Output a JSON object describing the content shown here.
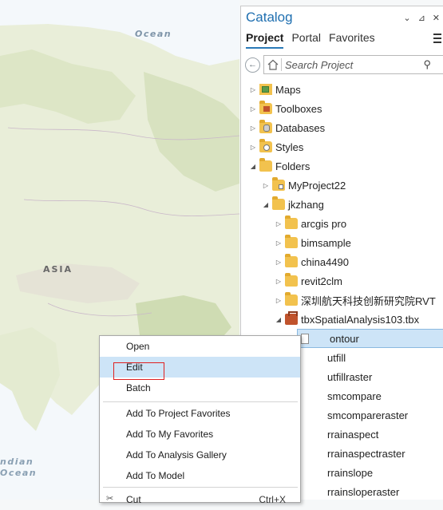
{
  "map": {
    "labels": {
      "ocean": "Ocean",
      "asia": "ASIA",
      "indian": "ndian",
      "indian_ocean": "Ocean"
    },
    "colors": {
      "land": "#e9eed9",
      "forest": "#cfdcb3",
      "water": "#f4f8fb"
    }
  },
  "catalog": {
    "title": "Catalog",
    "title_controls": [
      "⌄",
      "⊿",
      "✕"
    ],
    "tabs": [
      {
        "label": "Project",
        "active": true
      },
      {
        "label": "Portal",
        "active": false
      },
      {
        "label": "Favorites",
        "active": false
      }
    ],
    "search_placeholder": "Search Project",
    "tree": [
      {
        "label": "Maps",
        "level": 0,
        "icon": "maps-icon"
      },
      {
        "label": "Toolboxes",
        "level": 0,
        "icon": "toolbox-icon"
      },
      {
        "label": "Databases",
        "level": 0,
        "icon": "database-icon"
      },
      {
        "label": "Styles",
        "level": 0,
        "icon": "styles-icon"
      },
      {
        "label": "Folders",
        "level": 0,
        "icon": "folder-icon",
        "expanded": true
      },
      {
        "label": "MyProject22",
        "level": 1,
        "icon": "folder-icon"
      },
      {
        "label": "jkzhang",
        "level": 1,
        "icon": "folder-icon",
        "expanded": true
      },
      {
        "label": "arcgis pro",
        "level": 2,
        "icon": "folder-icon"
      },
      {
        "label": "bimsample",
        "level": 2,
        "icon": "folder-icon"
      },
      {
        "label": "china4490",
        "level": 2,
        "icon": "folder-icon"
      },
      {
        "label": "revit2clm",
        "level": 2,
        "icon": "folder-icon"
      },
      {
        "label": "深圳航天科技创新研究院RVT",
        "level": 2,
        "icon": "folder-icon"
      },
      {
        "label": "tbxSpatialAnalysis103.tbx",
        "level": 2,
        "icon": "toolbox-icon",
        "expanded": true
      },
      {
        "label": "ontour",
        "level": 3,
        "icon": "tool-icon",
        "selected": true
      },
      {
        "label": "utfill",
        "level": 3,
        "icon": "tool-icon"
      },
      {
        "label": "utfillraster",
        "level": 3,
        "icon": "tool-icon"
      },
      {
        "label": "smcompare",
        "level": 3,
        "icon": "tool-icon"
      },
      {
        "label": "smcompareraster",
        "level": 3,
        "icon": "tool-icon"
      },
      {
        "label": "rrainaspect",
        "level": 3,
        "icon": "tool-icon"
      },
      {
        "label": "rrainaspectraster",
        "level": 3,
        "icon": "tool-icon"
      },
      {
        "label": "rrainslope",
        "level": 3,
        "icon": "tool-icon"
      },
      {
        "label": "rrainsloperaster",
        "level": 3,
        "icon": "tool-icon"
      }
    ]
  },
  "context_menu": {
    "items": [
      {
        "label": "Open",
        "group": 0
      },
      {
        "label": "Edit",
        "group": 0,
        "hover": true,
        "highlighted": true
      },
      {
        "label": "Batch",
        "group": 0
      },
      {
        "label": "Add To Project Favorites",
        "group": 1
      },
      {
        "label": "Add To My Favorites",
        "group": 1
      },
      {
        "label": "Add To Analysis Gallery",
        "group": 1
      },
      {
        "label": "Add To Model",
        "group": 1
      },
      {
        "label": "Cut",
        "group": 2,
        "shortcut": "Ctrl+X"
      }
    ]
  }
}
